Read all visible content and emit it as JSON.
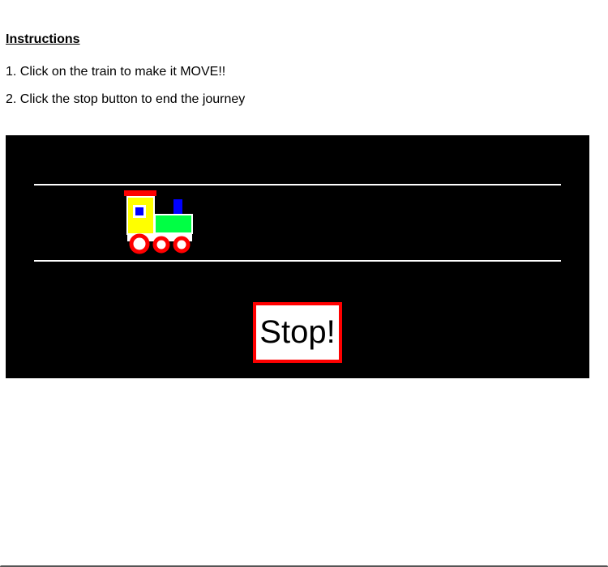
{
  "instructions": {
    "heading": "Instructions",
    "step1": "1. Click on the train to make it MOVE!!",
    "step2": "2. Click the stop button to end the journey"
  },
  "scene": {
    "background_color": "#000000",
    "rail_color": "#ffffff",
    "train_icon": "toy-train-icon",
    "train_colors": {
      "roof": "#ff0000",
      "cab": "#ffff00",
      "window": "#0000ff",
      "chimney": "#0000ff",
      "body": "#00ff44",
      "wheels": "#ff0000"
    }
  },
  "stop_button": {
    "label": "Stop!",
    "border_color": "#ff0000"
  }
}
